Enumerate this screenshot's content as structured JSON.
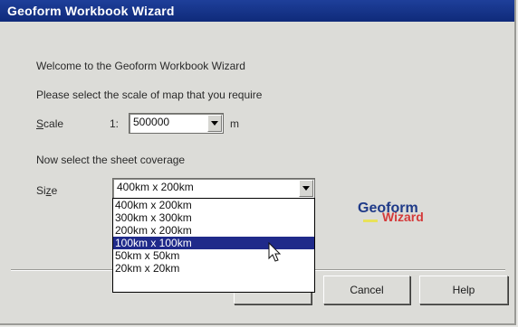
{
  "window": {
    "title": "Geoform Workbook Wizard"
  },
  "intro": {
    "welcome": "Welcome to the Geoform Workbook Wizard",
    "scale_prompt": "Please select the scale of map that you require"
  },
  "scale": {
    "label_first": "S",
    "label_rest": "cale",
    "ratio_prefix": "1:",
    "value": "500000",
    "unit": "m"
  },
  "coverage": {
    "prompt": "Now select the sheet coverage",
    "label_first": "Si",
    "label_underlined": "z",
    "label_rest": "e",
    "selected": "400km x 200km",
    "options": [
      {
        "label": "400km x 200km",
        "highlighted": false
      },
      {
        "label": "300km x 300km",
        "highlighted": false
      },
      {
        "label": "200km x 200km",
        "highlighted": false
      },
      {
        "label": "100km x 100km",
        "highlighted": true
      },
      {
        "label": "50km x 50km",
        "highlighted": false
      },
      {
        "label": "20km x 20km",
        "highlighted": false
      }
    ]
  },
  "logo": {
    "line1": "Geoform",
    "line2": "Wizard"
  },
  "buttons": {
    "cancel": "Cancel",
    "help": "Help"
  },
  "colors": {
    "titlebar": "#1e3f9a",
    "selection": "#1f2a8a",
    "logo_blue": "#1f3a88",
    "logo_red": "#d43a3a"
  }
}
